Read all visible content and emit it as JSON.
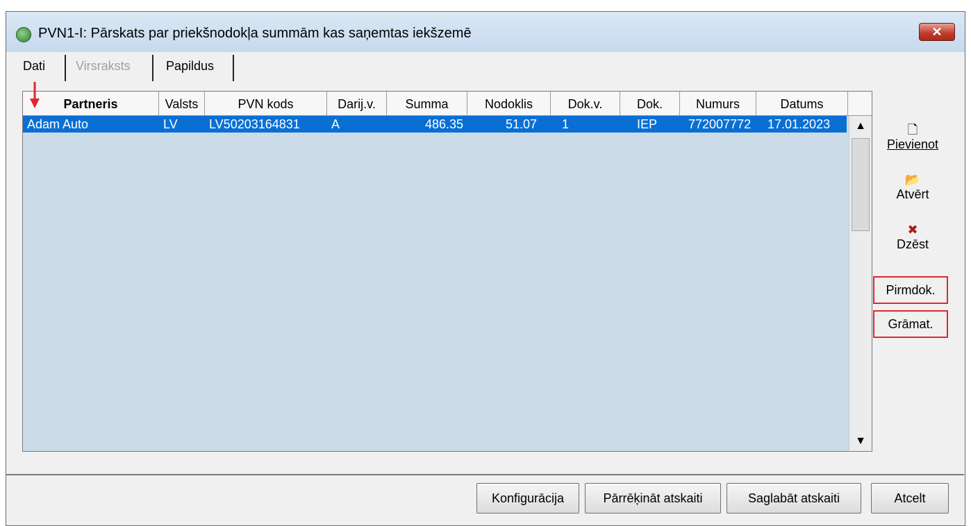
{
  "window": {
    "title": "PVN1-I: Pārskats par priekšnodokļa summām kas saņemtas iekšzemē",
    "close_label": "✕"
  },
  "tabs": [
    {
      "label": "Dati",
      "state": "active"
    },
    {
      "label": "Virsraksts",
      "state": "disabled"
    },
    {
      "label": "Papildus",
      "state": "normal"
    }
  ],
  "table": {
    "columns": [
      "Partneris",
      "Valsts",
      "PVN kods",
      "Darij.v.",
      "Summa",
      "Nodoklis",
      "Dok.v.",
      "Dok.",
      "Numurs",
      "Datums"
    ],
    "rows": [
      {
        "partneris": "Adam Auto",
        "valsts": "LV",
        "pvn_kods": "LV50203164831",
        "darij_v": "A",
        "summa": "486.35",
        "nodoklis": "51.07",
        "dok_v": "1",
        "dok": "IEP",
        "numurs": "772007772",
        "datums": "17.01.2023"
      }
    ],
    "scroll_up": "▲",
    "scroll_down": "▼"
  },
  "side_actions": {
    "add_icon": "🗋",
    "add_label": "Pievienot",
    "open_icon": "📂",
    "open_label": "Atvērt",
    "delete_icon": "✖",
    "delete_label": "Dzēst",
    "source_doc_label": "Pirmdok.",
    "ledger_label": "Grāmat."
  },
  "footer_buttons": {
    "config_label": "Konfigurācija",
    "recalc_label": "Pārrēķināt atskaiti",
    "save_label": "Saglabāt atskaiti",
    "cancel_label": "Atcelt"
  },
  "colors": {
    "selection": "#0a6fd4",
    "grid_bg": "#ccdbe8",
    "highlight_border": "#e0262d",
    "delete_icon": "#b01818"
  }
}
